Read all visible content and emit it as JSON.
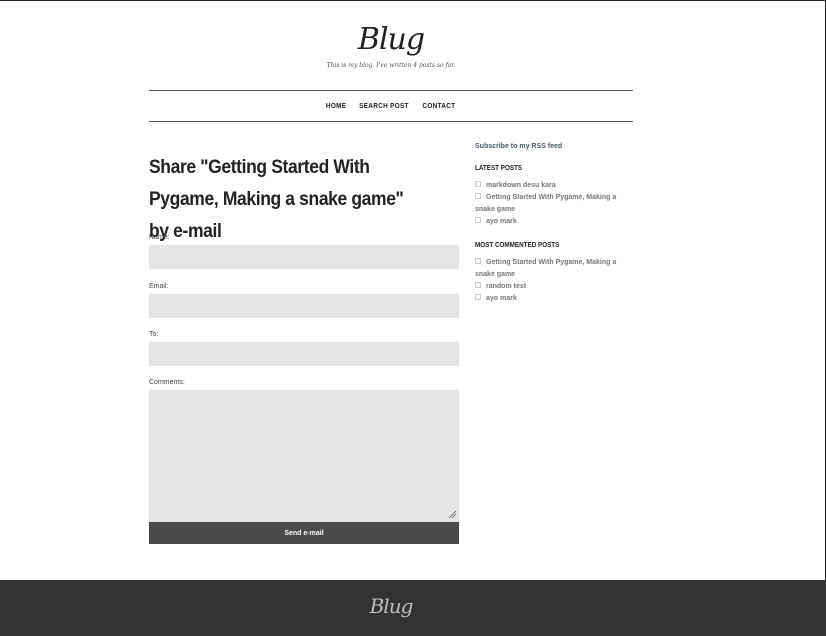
{
  "header": {
    "site_title": "Blug",
    "tagline": "This is my blog. I've written 4 posts so far."
  },
  "nav": {
    "items": [
      {
        "label": "HOME"
      },
      {
        "label": "SEARCH POST"
      },
      {
        "label": "CONTACT"
      }
    ]
  },
  "main": {
    "heading": "Share \"Getting Started With Pygame, Making a snake game\" by e-mail",
    "form": {
      "name_label": "Name:",
      "name_value": "",
      "email_label": "Email:",
      "email_value": "",
      "to_label": "To:",
      "to_value": "",
      "comments_label": "Comments:",
      "comments_value": "",
      "submit_label": "Send e-mail"
    }
  },
  "sidebar": {
    "rss_link": "Subscribe to my RSS feed",
    "latest_posts_title": "LATEST POSTS",
    "latest_posts": [
      {
        "label": "markdown desu kara"
      },
      {
        "label": "Getting Started With Pygame, Making a snake game"
      },
      {
        "label": "ayo mark"
      }
    ],
    "most_commented_title": "MOST COMMENTED POSTS",
    "most_commented": [
      {
        "label": "Getting Started With Pygame, Making a snake game"
      },
      {
        "label": "random test"
      },
      {
        "label": "ayo mark"
      }
    ]
  },
  "footer": {
    "logo": "Blug"
  },
  "colors": {
    "footer_bg": "#333333",
    "input_bg": "#e5e5e5",
    "button_bg": "#4a4a4a"
  },
  "icons": {
    "resize_handle": "resize-grip-icon",
    "list_bullet": "square-bullet-icon"
  }
}
